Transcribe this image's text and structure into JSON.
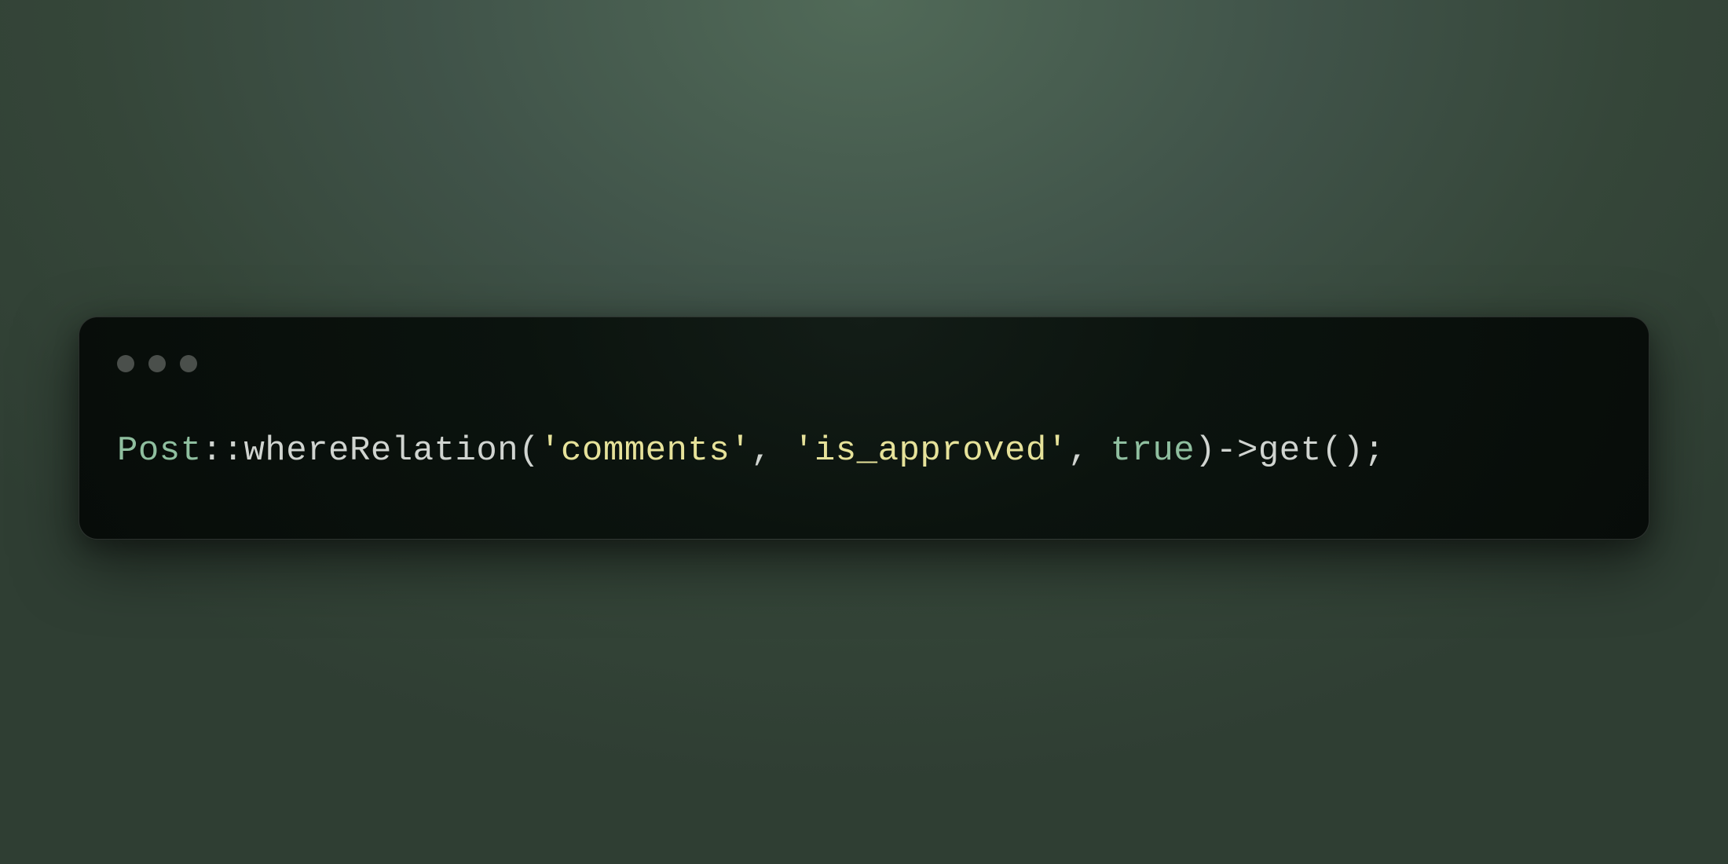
{
  "code": {
    "class_name": "Post",
    "scope_op": "::",
    "method1": "whereRelation",
    "paren_open": "(",
    "string1": "'comments'",
    "comma1": ", ",
    "string2": "'is_approved'",
    "comma2": ", ",
    "keyword_true": "true",
    "paren_close": ")",
    "arrow": "->",
    "method2": "get",
    "paren_open2": "(",
    "paren_close2": ")",
    "semicolon": ";"
  }
}
